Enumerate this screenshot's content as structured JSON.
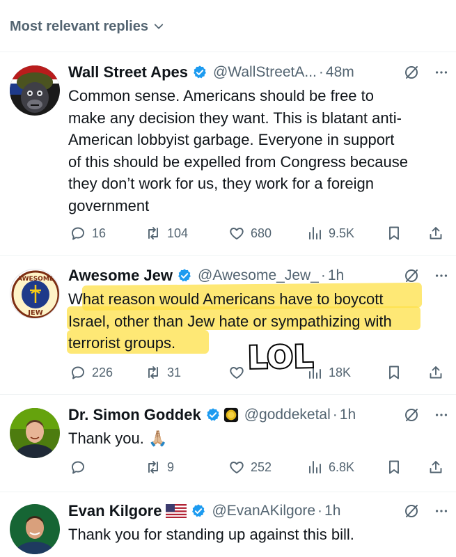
{
  "sort": {
    "label": "Most relevant replies"
  },
  "replies": [
    {
      "name": "Wall Street Apes",
      "handle": "@WallStreetA...",
      "time": "48m",
      "lines": [
        "Common sense. Americans should be free to",
        "make any decision they want. This is blatant anti-",
        "American lobbyist garbage. Everyone in support",
        "of this should be expelled from Congress because",
        "they don’t work for us, they work for a foreign",
        "government"
      ],
      "stats": {
        "replies": "16",
        "reposts": "104",
        "likes": "680",
        "views": "9.5K"
      }
    },
    {
      "name": "Awesome Jew",
      "handle": "@Awesome_Jew_",
      "time": "1h",
      "avatar_text": {
        "top": "AWESOME",
        "bottom": "JEW"
      },
      "lines": [
        "What reason would Americans have to boycott",
        "Israel, other than Jew hate or sympathizing with",
        "terrorist groups."
      ],
      "stats": {
        "replies": "226",
        "reposts": "31",
        "likes": "",
        "views": "18K"
      },
      "sticker": "LOL"
    },
    {
      "name": "Dr. Simon Goddek",
      "handle": "@goddeketal",
      "time": "1h",
      "lines": [
        "Thank you. 🙏🏼"
      ],
      "stats": {
        "replies": "",
        "reposts": "9",
        "likes": "252",
        "views": "6.8K"
      }
    },
    {
      "name": "Evan Kilgore",
      "handle": "@EvanAKilgore",
      "time": "1h",
      "lines": [
        "Thank you for standing up against this bill."
      ]
    }
  ],
  "colors": {
    "verified": "#1d9bf0",
    "affiliate_gold": "#e2b719",
    "highlight": "#fde047",
    "muted": "#536471"
  }
}
